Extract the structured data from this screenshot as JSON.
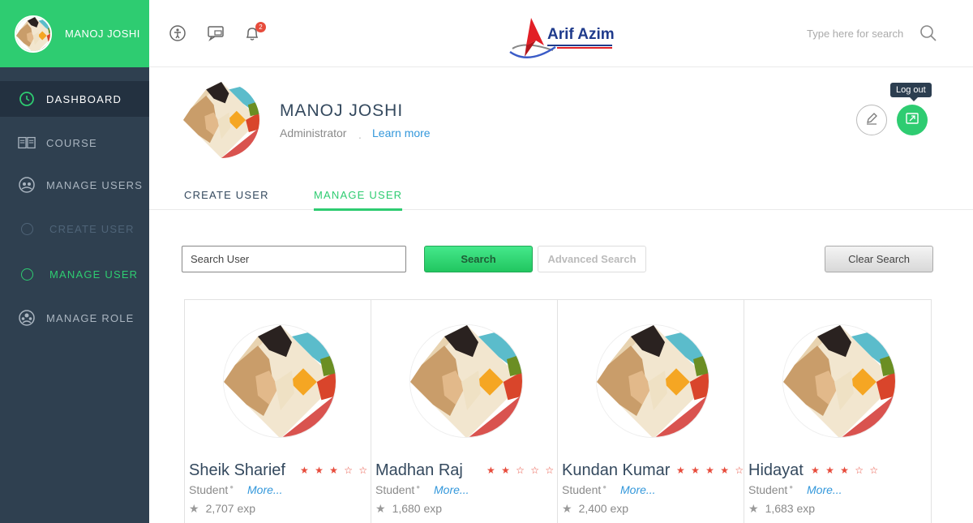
{
  "sidebar": {
    "user_name": "MANOJ JOSHI",
    "items": [
      {
        "label": "DASHBOARD",
        "icon": "dashboard-icon"
      },
      {
        "label": "COURSE",
        "icon": "book-icon"
      },
      {
        "label": "MANAGE USERS",
        "icon": "users-icon"
      },
      {
        "label": "CREATE USER",
        "icon": "circle-icon"
      },
      {
        "label": "MANAGE USER",
        "icon": "circle-icon"
      },
      {
        "label": "MANAGE ROLE",
        "icon": "role-icon"
      }
    ]
  },
  "topbar": {
    "notification_count": "2",
    "logo_text": "Arif Azim",
    "search_placeholder": "Type here for search"
  },
  "profile": {
    "name": "MANOJ JOSHI",
    "role": "Administrator",
    "separator": ".",
    "learn_more": "Learn more",
    "logout_tooltip": "Log out"
  },
  "tabs": {
    "create": "CREATE USER",
    "manage": "MANAGE USER"
  },
  "search": {
    "placeholder": "Search User",
    "search_label": "Search",
    "advanced_label": "Advanced Search",
    "clear_label": "Clear Search"
  },
  "users": [
    {
      "name": "Sheik Sharief",
      "stars": "★ ★ ★ ☆ ☆",
      "rating": 3,
      "role": "Student",
      "more": "More...",
      "exp": "2,707 exp"
    },
    {
      "name": "Madhan Raj",
      "stars": "★ ★ ☆ ☆ ☆",
      "rating": 2,
      "role": "Student",
      "more": "More...",
      "exp": "1,680 exp"
    },
    {
      "name": "Kundan Kumar",
      "stars": "★ ★ ★ ★ ☆",
      "rating": 4,
      "role": "Student",
      "more": "More...",
      "exp": "2,400 exp"
    },
    {
      "name": "Hidayat",
      "stars": "★ ★ ★ ☆ ☆",
      "rating": 3,
      "role": "Student",
      "more": "More...",
      "exp": "1,683 exp"
    }
  ],
  "colors": {
    "accent": "#2ecc71",
    "sidebar": "#2f4050",
    "link": "#3498db",
    "star": "#e74c3c"
  }
}
